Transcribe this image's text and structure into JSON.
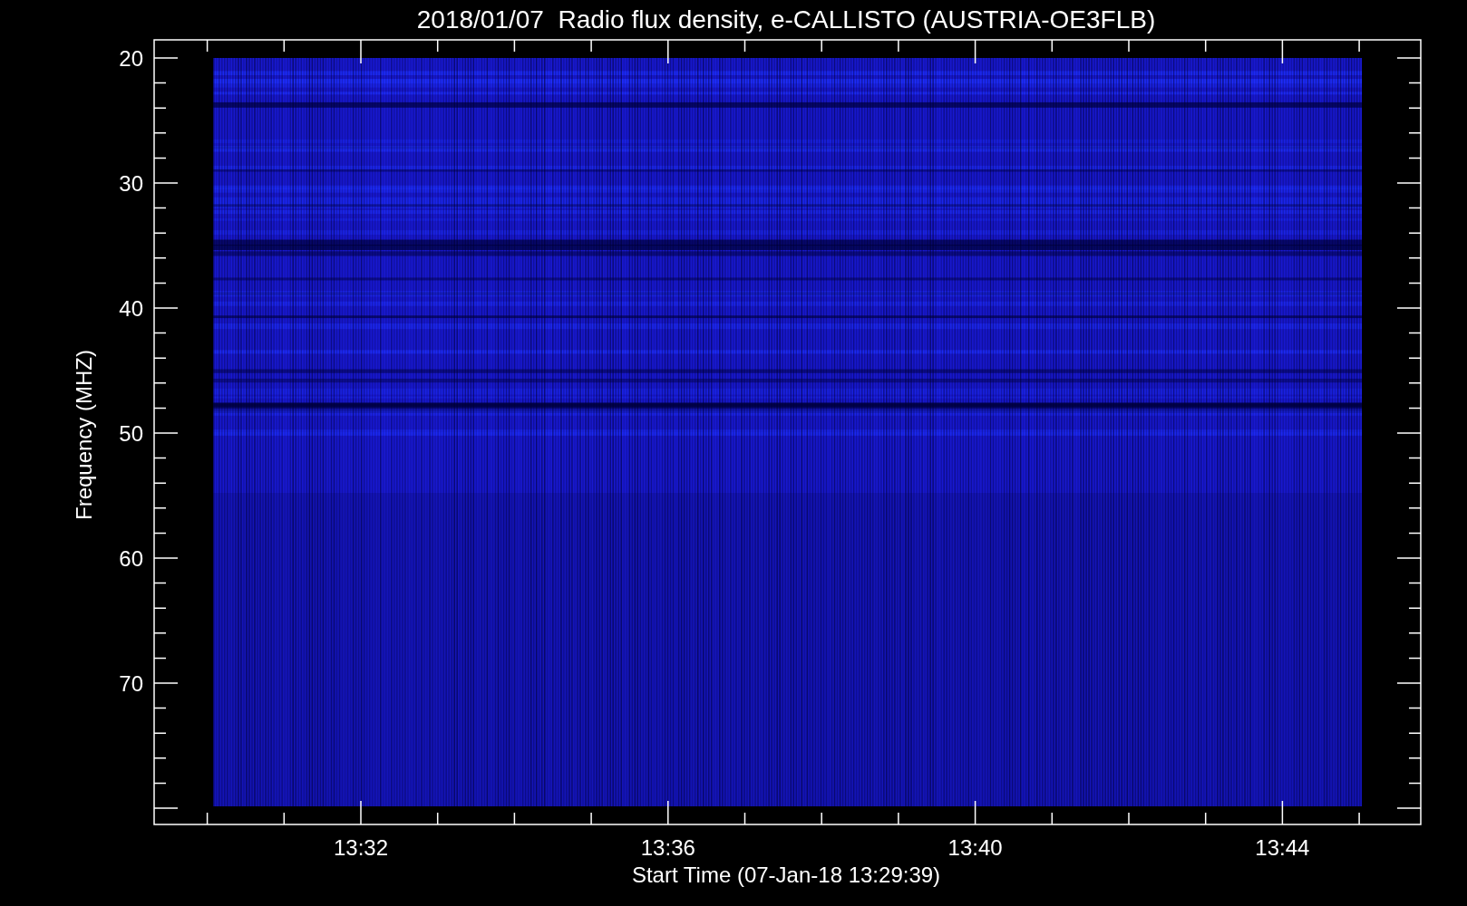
{
  "title": "2018/01/07  Radio flux density, e-CALLISTO (AUSTRIA-OE3FLB)",
  "plot": {
    "ylabel": "Frequency (MHZ)",
    "xlabel": "Start Time (07-Jan-18 13:29:39)",
    "y_tick_labels": [
      "20",
      "30",
      "40",
      "50",
      "60",
      "70"
    ],
    "x_tick_labels": [
      "13:32",
      "13:36",
      "13:40",
      "13:44"
    ]
  }
}
